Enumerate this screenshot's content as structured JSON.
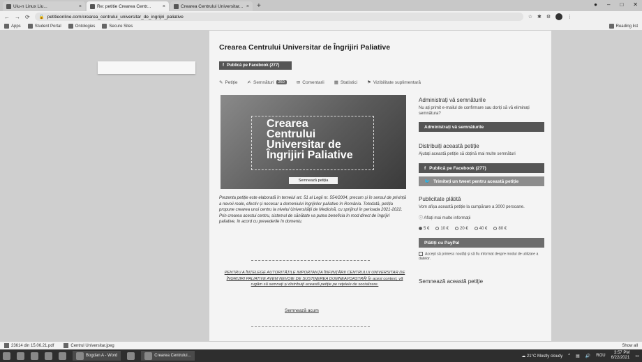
{
  "browser": {
    "tabs": [
      {
        "label": "Uiu-n Linux Liu...",
        "active": false
      },
      {
        "label": "Re: petitie Crearea Centr...",
        "active": true
      },
      {
        "label": "Crearea Centrului Universitar...",
        "active": false
      }
    ],
    "url": "petitieonline.com/crearea_centrului_universitar_de_ingrijiri_paliative",
    "bookmarks": [
      "Apps",
      "Student Portal",
      "Ontologies",
      "Secure Sites",
      "Reading list"
    ]
  },
  "page": {
    "title": "Crearea Centrului Universitar de Îngrijiri Paliative",
    "fb_button_small": "Publică pe Facebook (277)",
    "tabs": [
      {
        "label": "Petiție",
        "icon": "pencil-icon"
      },
      {
        "label": "Semnături",
        "badge": "260",
        "icon": "signatures-icon"
      },
      {
        "label": "Comentarii",
        "icon": "comments-icon"
      },
      {
        "label": "Statistici",
        "icon": "stats-icon"
      },
      {
        "label": "Vizibilitate suplimentară",
        "icon": "megaphone-icon"
      }
    ],
    "hero": {
      "line1": "Crearea",
      "line2": "Centrului",
      "line3": "Universitar de",
      "line4": "Îngrijiri Paliative",
      "button": "Semnează petiția"
    },
    "description": "Prezenta petiție este elaborată în temeiul art. 51 al Legii nr. 554/2004, precum și în sensul de privință a nevoii reale, efectiv și necesar a domeniului îngrijirilor paliative în România. Totodată, petiția propune crearea unui centru la nivelul Universității de Medicină, cu sprijinul în perioada 2021-2022. Prin crearea acestui centru, sistemul de sănătate va putea beneficia în mod direct de îngrijiri paliative, în acord cu prevederile în domeniu.",
    "petition_caps": "PENTRU A ÎNȚELEGE AUTORITĂȚILE IMPORTANȚA ÎNFIINȚĂRII CENTRULUI UNIVERSITAR DE ÎNGRIJIRI PALIATIVE AVEM NEVOIE DE SUSȚINEREA DUMNEAVOASTRĂ! În acest context, vă rugăm să semnați și distribuiți această petiție pe rețelele de socializare.",
    "email_link": "Semnează acum"
  },
  "sidebar": {
    "admin": {
      "title": "Administrați vă semnăturile",
      "text": "Nu ați primit e-mailul de confirmare sau doriți să vă eliminați semnătura?",
      "button": "Administrați vă semnăturile"
    },
    "share": {
      "title": "Distribuiți această petiție",
      "text": "Ajutați această petiție să obțină mai multe semnături",
      "fb_button": "Publică pe Facebook (277)",
      "tw_button": "Trimiteți un tweet pentru această petiție"
    },
    "promo": {
      "title": "Publicitate plătită",
      "text": "Vom afișa această petiție la cumpărare a 3000 persoane.",
      "info": "Aflați mai multe informații",
      "amounts": [
        "5 €",
        "10 €",
        "20 €",
        "40 €",
        "80 €"
      ],
      "selected": "5 €",
      "button": "Plătiți cu PayPal",
      "consent": "Accept să primesc noutăți și să fiu informat despre modul de utilizare a datelor."
    },
    "sign_title": "Semnează această petiție"
  },
  "downloads": {
    "item1": "23614 din 15.06.21.pdf",
    "item2": "Centrul Universitar.jpeg",
    "show_all": "Show all"
  },
  "taskbar": {
    "app1": "Bogdan A - Word",
    "app2": "Crearea Centrului...",
    "weather": "21°C Mostly cloudy",
    "lang": "ROU",
    "time": "3:57 PM",
    "date": "6/22/2021"
  }
}
